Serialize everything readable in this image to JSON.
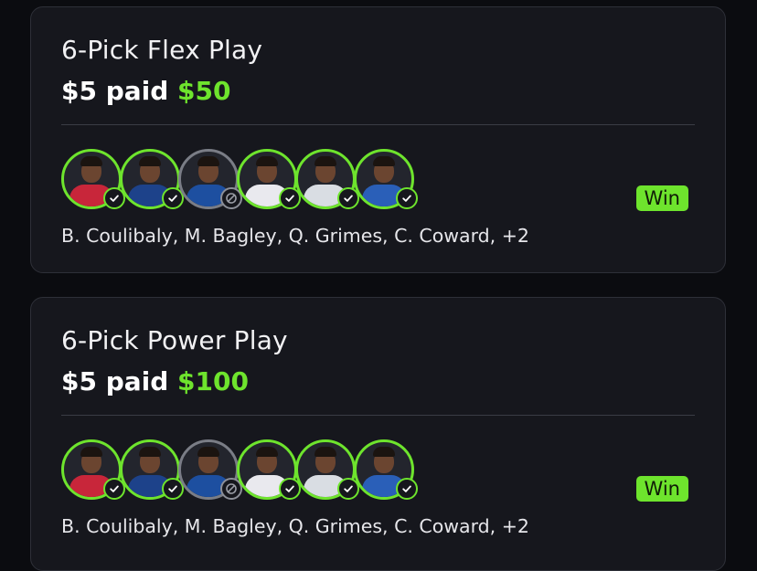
{
  "entries": [
    {
      "title": "6-Pick Flex Play",
      "paid_prefix": "$5 paid",
      "paid_amount": "$50",
      "badge": "Win",
      "players": "B. Coulibaly, M. Bagley, Q. Grimes, C. Coward, +2",
      "picks": [
        {
          "result": "check",
          "jersey": "#c8263a"
        },
        {
          "result": "check",
          "jersey": "#1d428a"
        },
        {
          "result": "void",
          "jersey": "#1d4fa0"
        },
        {
          "result": "check",
          "jersey": "#e9e9ee"
        },
        {
          "result": "check",
          "jersey": "#d9dde3"
        },
        {
          "result": "check",
          "jersey": "#2a5fb8"
        }
      ]
    },
    {
      "title": "6-Pick Power Play",
      "paid_prefix": "$5 paid",
      "paid_amount": "$100",
      "badge": "Win",
      "players": "B. Coulibaly, M. Bagley, Q. Grimes, C. Coward, +2",
      "picks": [
        {
          "result": "check",
          "jersey": "#c8263a"
        },
        {
          "result": "check",
          "jersey": "#1d428a"
        },
        {
          "result": "void",
          "jersey": "#1d4fa0"
        },
        {
          "result": "check",
          "jersey": "#e9e9ee"
        },
        {
          "result": "check",
          "jersey": "#d9dde3"
        },
        {
          "result": "check",
          "jersey": "#2a5fb8"
        }
      ]
    }
  ],
  "colors": {
    "accent": "#6ee42d",
    "card_bg": "#16171d",
    "page_bg": "#0b0c10"
  },
  "icons": {
    "check": "check-icon",
    "void": "void-icon"
  }
}
